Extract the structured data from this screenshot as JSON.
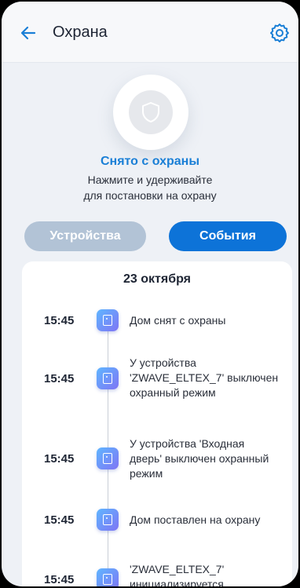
{
  "header": {
    "title": "Охрана",
    "back_icon": "arrow-left-icon",
    "settings_icon": "gear-icon"
  },
  "arm": {
    "icon": "shield-icon",
    "status": "Снято с охраны",
    "hint_line1": "Нажмите и удерживайте",
    "hint_line2": "для постановки на охрану"
  },
  "tabs": [
    {
      "label": "Устройства",
      "active": false
    },
    {
      "label": "События",
      "active": true
    }
  ],
  "events": {
    "date": "23 октября",
    "items": [
      {
        "time": "15:45",
        "text": "Дом снят с охраны",
        "icon": "device-icon"
      },
      {
        "time": "15:45",
        "text": "У устройства 'ZWAVE_ELTEX_7' выключен охранный режим",
        "icon": "device-icon"
      },
      {
        "time": "15:45",
        "text": "У устройства 'Входная дверь' выключен охранный режим",
        "icon": "device-icon"
      },
      {
        "time": "15:45",
        "text": "Дом поставлен на охрану",
        "icon": "device-icon"
      },
      {
        "time": "15:45",
        "text": "'ZWAVE_ELTEX_7' инициализируется",
        "icon": "device-icon"
      }
    ]
  },
  "colors": {
    "accent": "#0d73d8",
    "tab_inactive": "#b2c3d6",
    "status_text": "#1a7fd6",
    "background": "#eef1f6"
  }
}
